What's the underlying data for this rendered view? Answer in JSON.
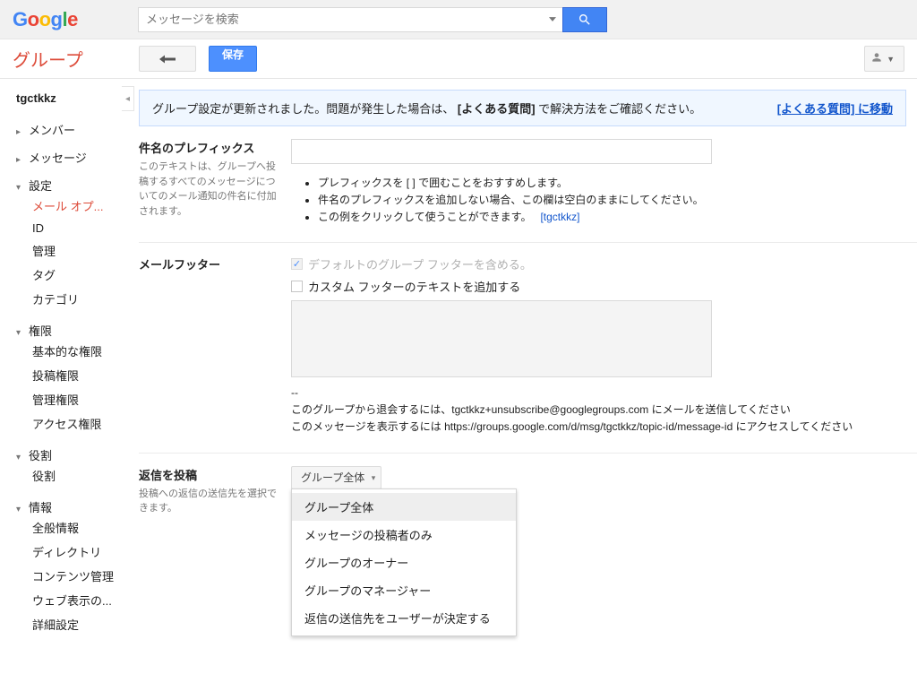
{
  "header": {
    "search_placeholder": "メッセージを検索",
    "app_title": "グループ",
    "save_label": "保存"
  },
  "group_name": "tgctkkz",
  "nav": {
    "members": "メンバー",
    "messages": "メッセージ",
    "settings": "設定",
    "settings_items": {
      "mail_options": "メール オプ...",
      "id": "ID",
      "manage": "管理",
      "tags": "タグ",
      "categories": "カテゴリ"
    },
    "permissions": "権限",
    "permissions_items": {
      "basic": "基本的な権限",
      "post": "投稿権限",
      "manage": "管理権限",
      "access": "アクセス権限"
    },
    "roles": "役割",
    "roles_items": {
      "roles": "役割"
    },
    "info": "情報",
    "info_items": {
      "general": "全般情報",
      "directory": "ディレクトリ",
      "content": "コンテンツ管理",
      "web": "ウェブ表示の...",
      "advanced": "詳細設定"
    }
  },
  "alert": {
    "msg_prefix": "グループ設定が更新されました。問題が発生した場合は、",
    "msg_bold": "[よくある質問]",
    "msg_suffix": " で解決方法をご確認ください。",
    "link": "[よくある質問] に移動"
  },
  "prefix": {
    "title": "件名のプレフィックス",
    "desc": "このテキストは、グループへ投稿するすべてのメッセージについてのメール通知の件名に付加されます。",
    "b1": "プレフィックスを [ ] で囲むことをおすすめします。",
    "b2": "件名のプレフィックスを追加しない場合、この欄は空白のままにしてください。",
    "b3_a": "この例をクリックして使うことができます。",
    "b3_link": "[tgctkkz]"
  },
  "footer": {
    "title": "メールフッター",
    "chk_default": "デフォルトのグループ フッターを含める。",
    "chk_custom": "カスタム フッターのテキストを追加する",
    "dashes": "--",
    "l1": "このグループから退会するには、tgctkkz+unsubscribe@googlegroups.com にメールを送信してください",
    "l2": "このメッセージを表示するには https://groups.google.com/d/msg/tgctkkz/topic-id/message-id にアクセスしてください"
  },
  "reply": {
    "title": "返信を投稿",
    "desc": "投稿への返信の送信先を選択できます。",
    "selected": "グループ全体",
    "options": {
      "o1": "グループ全体",
      "o2": "メッセージの投稿者のみ",
      "o3": "グループのオーナー",
      "o4": "グループのマネージャー",
      "o5": "返信の送信先をユーザーが決定する"
    }
  }
}
